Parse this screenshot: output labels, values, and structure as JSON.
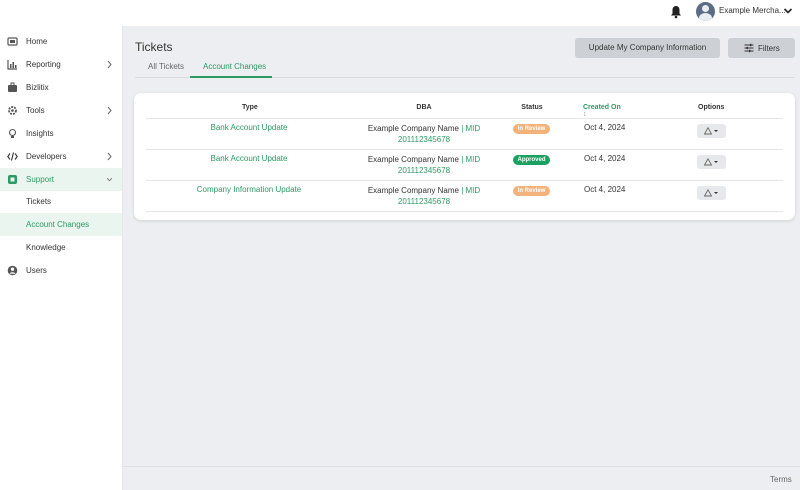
{
  "header": {
    "user_name": "Example Mercha...",
    "notification_icon": "bell-icon",
    "avatar_icon": "user-avatar-icon"
  },
  "sidebar": {
    "items": [
      {
        "label": "Home",
        "icon": "home-icon"
      },
      {
        "label": "Reporting",
        "icon": "bar-chart-icon"
      },
      {
        "label": "Bizlitix",
        "icon": "briefcase-icon"
      },
      {
        "label": "Tools",
        "icon": "gear-icon"
      },
      {
        "label": "Insights",
        "icon": "lightbulb-icon"
      },
      {
        "label": "Developers",
        "icon": "code-icon"
      },
      {
        "label": "Support",
        "icon": "support-icon"
      },
      {
        "label": "Users",
        "icon": "user-icon"
      }
    ],
    "support_children": [
      "Tickets",
      "Account Changes",
      "Knowledge"
    ],
    "active_color": "#2c9a65"
  },
  "page": {
    "title": "Tickets",
    "update_button": "Update My Company Information",
    "filters_button": "Filters",
    "tabs": [
      "All Tickets",
      "Account Changes"
    ],
    "active_tab": "Account Changes"
  },
  "table": {
    "headers": {
      "type": "Type",
      "dba": "DBA",
      "status": "Status",
      "created_on": "Created On",
      "options": "Options"
    },
    "sort_indicator": "↕",
    "rows": [
      {
        "type": "Bank Account Update",
        "dba_name": "Example Company Name",
        "sep": "|",
        "mid": "MID",
        "mid_number": "201112345678",
        "status": "In Review",
        "created": "Oct 4, 2024"
      },
      {
        "type": "Bank Account Update",
        "dba_name": "Example Company Name",
        "sep": "|",
        "mid": "MID",
        "mid_number": "201112345678",
        "status": "Approved",
        "created": "Oct 4, 2024"
      },
      {
        "type": "Company Information Update",
        "dba_name": "Example Company Name",
        "sep": "|",
        "mid": "MID",
        "mid_number": "201112345678",
        "status": "In Review",
        "created": "Oct 4, 2024"
      }
    ],
    "status_colors": {
      "In Review": "#f2b27a",
      "Approved": "#1aa061"
    }
  },
  "footer": {
    "terms": "Terms"
  }
}
